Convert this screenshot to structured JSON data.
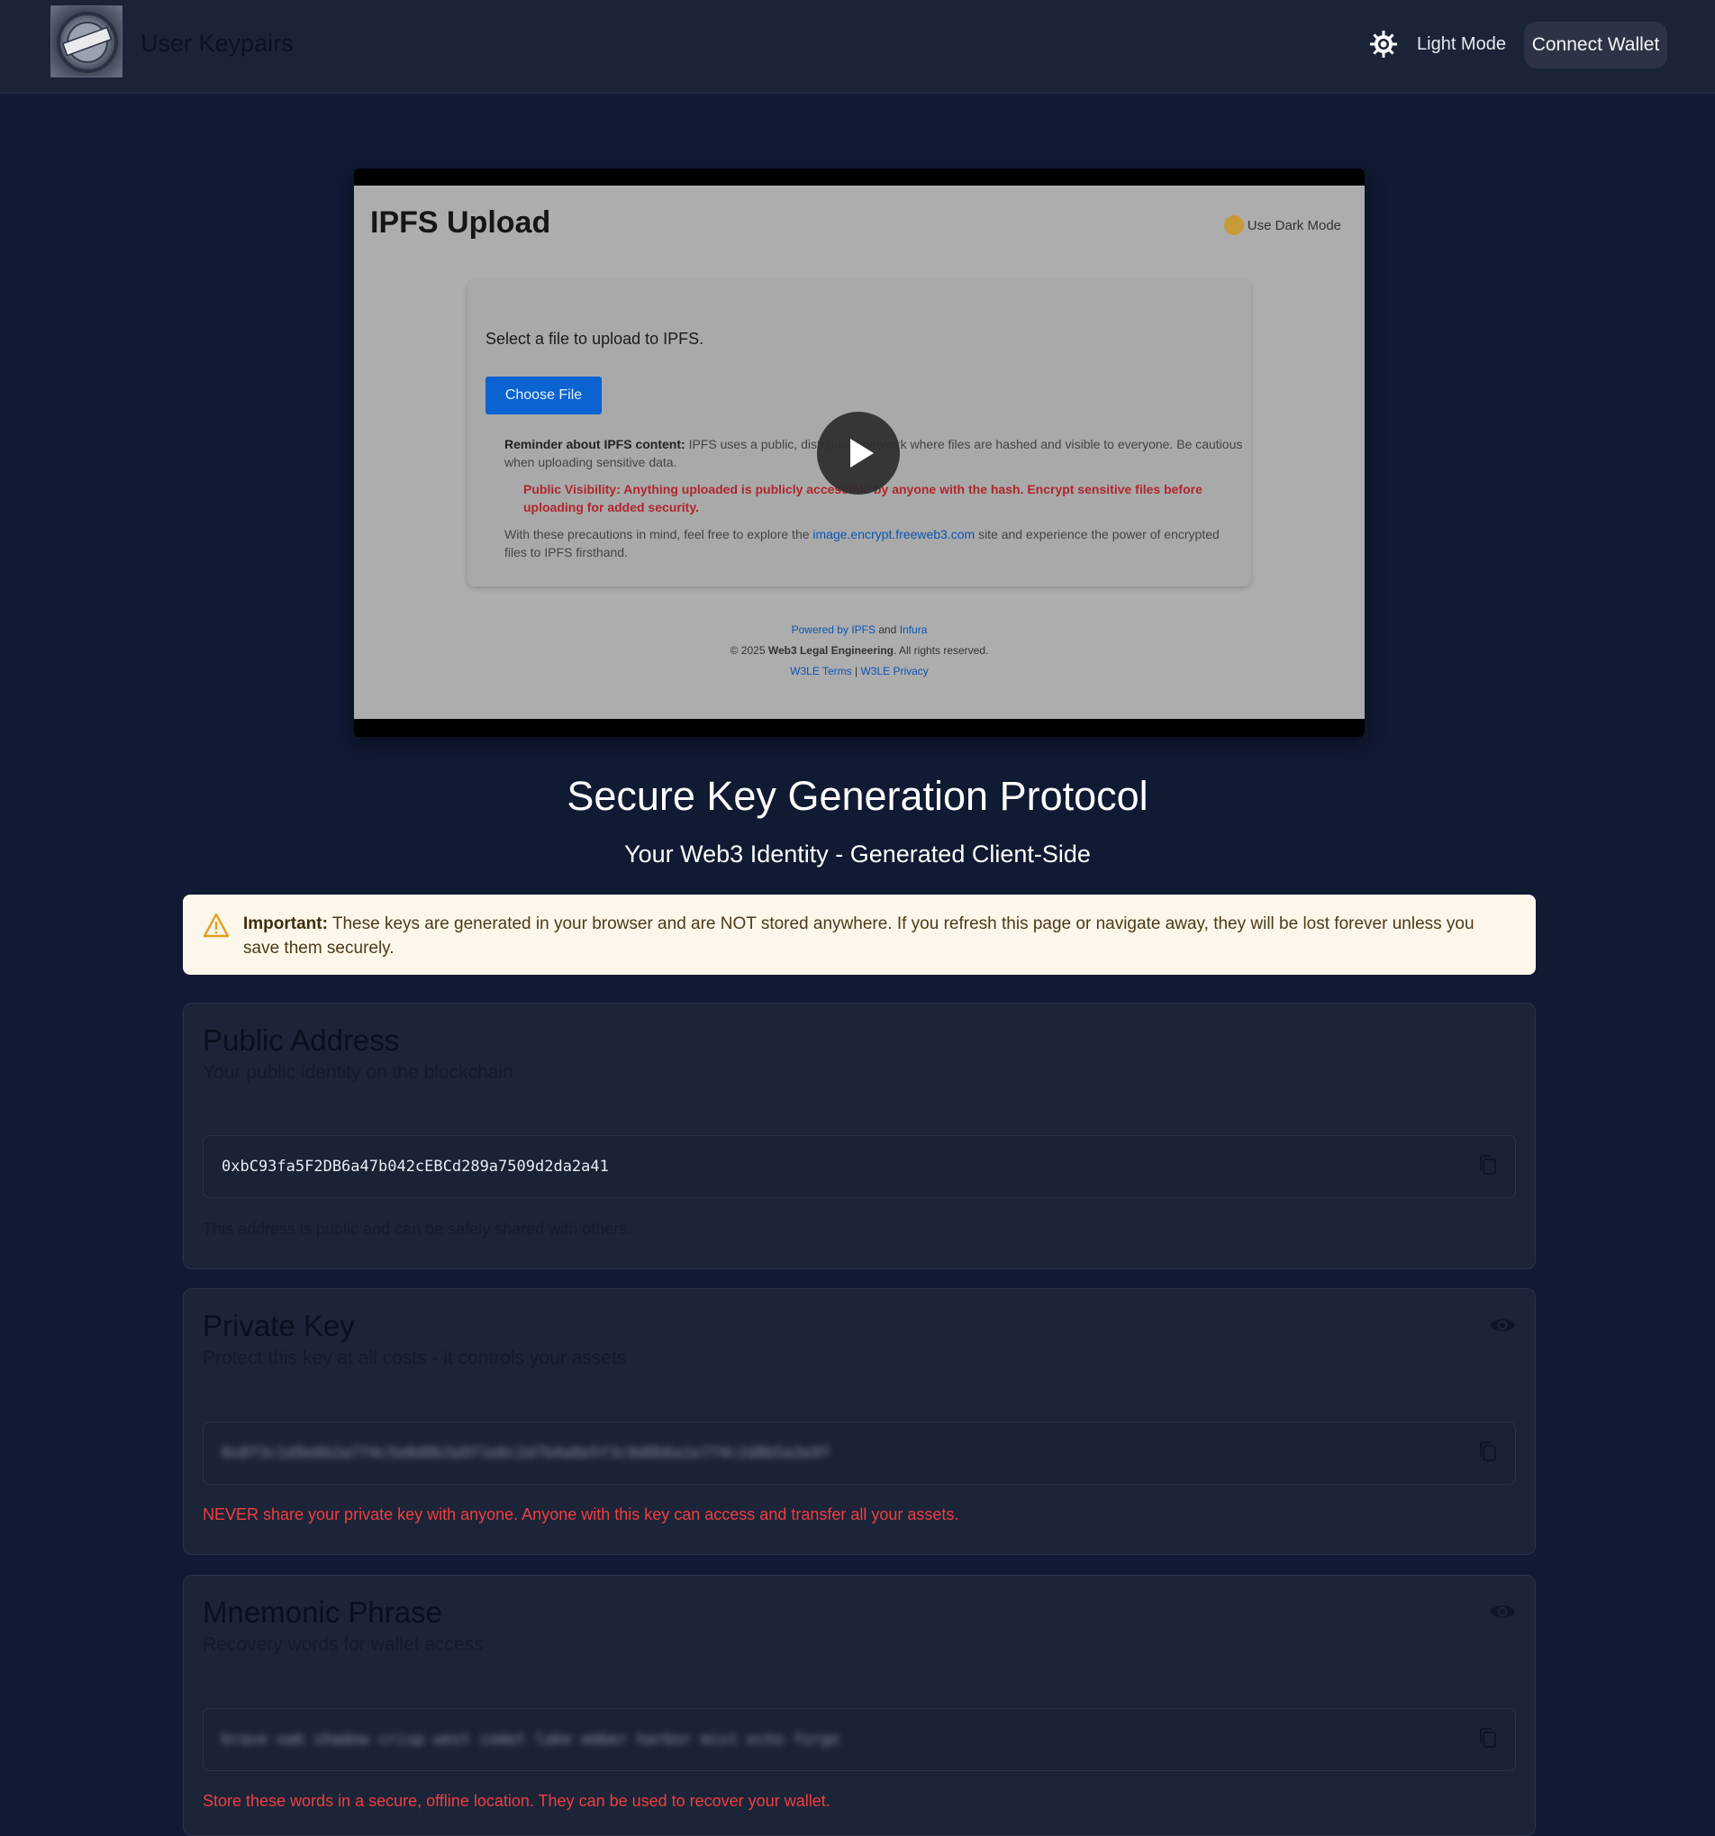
{
  "header": {
    "app_title": "User Keypairs",
    "theme_label": "Light Mode",
    "theme_icon": "sun-icon",
    "connect_label": "Connect Wallet"
  },
  "video": {
    "title": "IPFS Upload",
    "dark_mode_label": "Use Dark Mode",
    "select_prompt": "Select a file to upload to IPFS.",
    "choose_file_label": "Choose File",
    "reminder_bold": "Reminder about IPFS content:",
    "reminder_text": "IPFS uses a public, distributed network where files are hashed and visible to everyone. Be cautious when uploading sensitive data.",
    "visibility_warning": "Public Visibility: Anything uploaded is publicly accessible by anyone with the hash. Encrypt sensitive files before uploading for added security.",
    "precaution_before": "With these precautions in mind, feel free to explore the",
    "precaution_link": "image.encrypt.freeweb3.com",
    "precaution_after": "site and experience the power of encrypted files to IPFS firsthand.",
    "footer_powered_prefix": "Powered by",
    "footer_ipfs": "IPFS",
    "footer_and": "and",
    "footer_infura": "Infura",
    "footer_copyright_prefix": "© 2025",
    "footer_company": "Web3 Legal Engineering",
    "footer_rights": ". All rights reserved.",
    "footer_terms": "W3LE Terms",
    "footer_separator": "|",
    "footer_privacy": "W3LE Privacy",
    "play_icon": "play-icon"
  },
  "main": {
    "title": "Secure Key Generation Protocol",
    "subtitle": "Your Web3 Identity - Generated Client-Side"
  },
  "alert": {
    "label": "Important:",
    "text": "These keys are generated in your browser and are NOT stored anywhere. If you refresh this page or navigate away, they will be lost forever unless you save them securely."
  },
  "public_address": {
    "title": "Public Address",
    "subtitle": "Your public identity on the blockchain",
    "value": "0xbC93fa5F2DB6a47b042cEBCd289a7509d2da2a41",
    "note": "This address is public and can be safely shared with others."
  },
  "private_key": {
    "title": "Private Key",
    "subtitle": "Protect this key at all costs - it controls your assets",
    "masked_value": "0x8f3c1d9e6b2a7f4c5e0d8b3a9f1e6c2d7b4a8e5f3c9d0b6a1e7f4c2d8b5a3e9f",
    "note": "NEVER share your private key with anyone. Anyone with this key can access and transfer all your assets."
  },
  "mnemonic": {
    "title": "Mnemonic Phrase",
    "subtitle": "Recovery words for wallet access",
    "masked_value": "brave oak shadow crisp west comet lake ember harbor mist echo forge",
    "note": "Store these words in a secure, offline location. They can be used to recover your wallet."
  }
}
